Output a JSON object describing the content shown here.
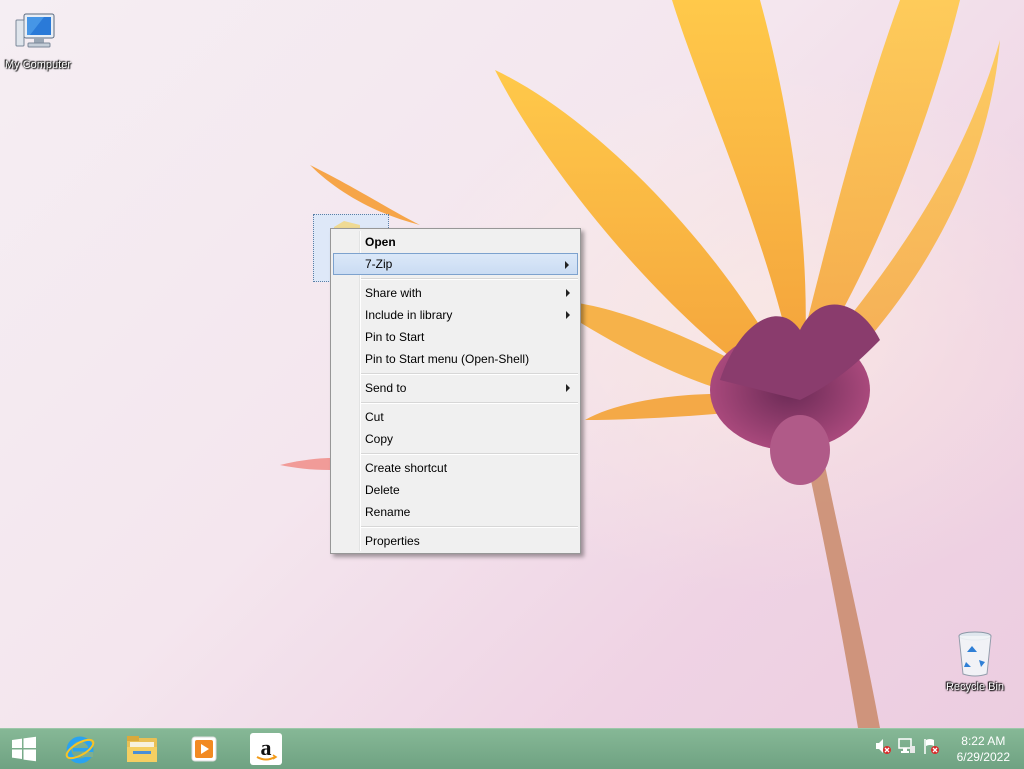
{
  "desktop": {
    "icons": [
      {
        "label": "My Computer"
      },
      {
        "label": "Recycle Bin"
      }
    ]
  },
  "context_menu": {
    "items": [
      {
        "label": "Open",
        "bold": true
      },
      {
        "label": "7-Zip",
        "submenu": true,
        "highlighted": true
      },
      {
        "label": "Share with",
        "submenu": true
      },
      {
        "label": "Include in library",
        "submenu": true
      },
      {
        "label": "Pin to Start"
      },
      {
        "label": "Pin to Start menu (Open-Shell)"
      },
      {
        "label": "Send to",
        "submenu": true
      },
      {
        "label": "Cut"
      },
      {
        "label": "Copy"
      },
      {
        "label": "Create shortcut"
      },
      {
        "label": "Delete"
      },
      {
        "label": "Rename"
      },
      {
        "label": "Properties"
      }
    ]
  },
  "taskbar": {
    "pinned": [
      {
        "icon": "windows-start-icon"
      },
      {
        "icon": "internet-explorer-icon"
      },
      {
        "icon": "file-explorer-icon"
      },
      {
        "icon": "media-player-icon"
      },
      {
        "icon": "amazon-icon"
      }
    ],
    "tray": [
      {
        "icon": "volume-muted-icon"
      },
      {
        "icon": "network-icon"
      },
      {
        "icon": "action-center-flag-icon"
      }
    ],
    "clock": {
      "time": "8:22 AM",
      "date": "6/29/2022"
    }
  },
  "colors": {
    "taskbar": "#7fae8f",
    "menu_highlight": "#cadcf3",
    "menu_background": "#f0f0f0"
  }
}
